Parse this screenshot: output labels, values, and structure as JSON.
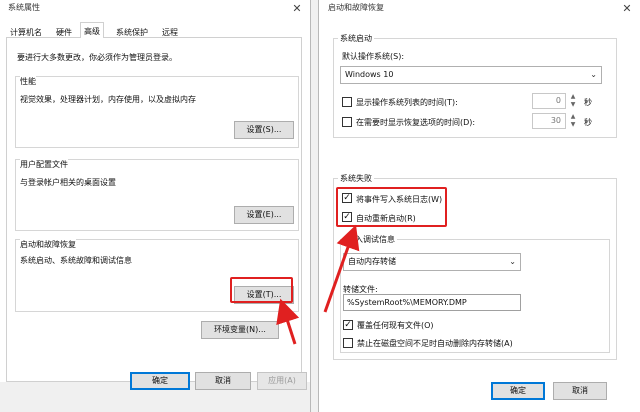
{
  "left": {
    "title": "系统属性",
    "tabs": [
      "计算机名",
      "硬件",
      "高级",
      "系统保护",
      "远程"
    ],
    "active_tab": "高级",
    "admin_note": "要进行大多数更改，你必须作为管理员登录。",
    "performance": {
      "heading": "性能",
      "desc": "视觉效果，处理器计划，内存使用，以及虚拟内存",
      "button": "设置(S)..."
    },
    "profile": {
      "heading": "用户配置文件",
      "desc": "与登录帐户相关的桌面设置",
      "button": "设置(E)..."
    },
    "startup": {
      "heading": "启动和故障恢复",
      "desc": "系统启动、系统故障和调试信息",
      "button": "设置(T)..."
    },
    "env_button": "环境变量(N)...",
    "ok": "确定",
    "cancel": "取消",
    "apply": "应用(A)"
  },
  "right": {
    "title": "启动和故障恢复",
    "system_startup": {
      "heading": "系统启动",
      "default_os_label": "默认操作系统(S):",
      "default_os_value": "Windows 10",
      "show_list_label": "显示操作系统列表的时间(T):",
      "show_list_value": "0",
      "show_recovery_label": "在需要时显示恢复选项的时间(D):",
      "show_recovery_value": "30",
      "unit": "秒"
    },
    "system_failure": {
      "heading": "系统失败",
      "write_event_label": "将事件写入系统日志(W)",
      "write_event_checked": true,
      "auto_restart_label": "自动重新启动(R)",
      "auto_restart_checked": true,
      "debug_heading": "写入调试信息",
      "debug_value": "自动内存转储",
      "dump_file_label": "转储文件:",
      "dump_file_value": "%SystemRoot%\\MEMORY.DMP",
      "overwrite_label": "覆盖任何现有文件(O)",
      "overwrite_checked": true,
      "disable_auto_delete_label": "禁止在磁盘空间不足时自动删除内存转储(A)",
      "disable_auto_delete_checked": false
    },
    "ok": "确定",
    "cancel": "取消"
  },
  "colors": {
    "highlight_red": "#e02020",
    "button_default_border": "#0078d7"
  }
}
